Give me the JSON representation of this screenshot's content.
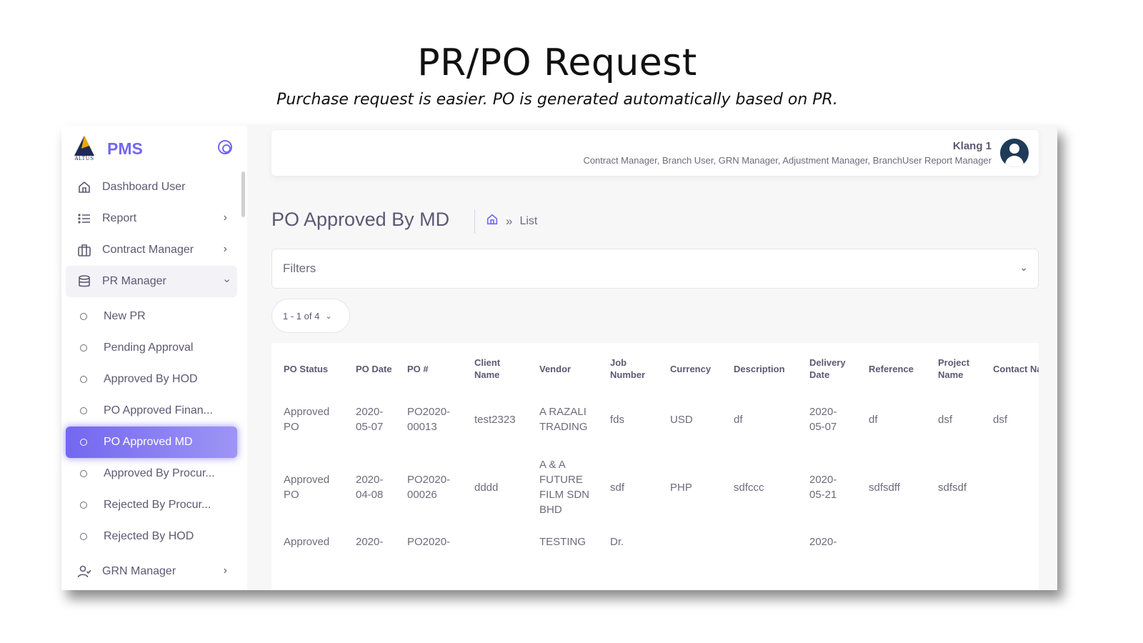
{
  "slide": {
    "title": "PR/PO Request",
    "subtitle": "Purchase request is easier. PO is generated automatically based on PR."
  },
  "app": {
    "name": "PMS",
    "logo_text": "ALTUS",
    "accent_color": "#7367f0"
  },
  "sidebar": {
    "items": [
      {
        "label": "Dashboard User",
        "icon": "home-icon"
      },
      {
        "label": "Report",
        "icon": "list-icon"
      },
      {
        "label": "Contract Manager",
        "icon": "briefcase-icon"
      },
      {
        "label": "PR Manager",
        "icon": "database-icon"
      }
    ],
    "pr_sub_items": [
      {
        "label": "New PR"
      },
      {
        "label": "Pending Approval"
      },
      {
        "label": "Approved By HOD"
      },
      {
        "label": "PO Approved Finan..."
      },
      {
        "label": "PO Approved MD",
        "active": true
      },
      {
        "label": "Approved By Procur..."
      },
      {
        "label": "Rejected By Procur..."
      },
      {
        "label": "Rejected By HOD"
      }
    ],
    "grn": {
      "label": "GRN Manager",
      "icon": "user-check-icon"
    }
  },
  "header": {
    "user_name": "Klang 1",
    "user_roles": "Contract Manager, Branch User, GRN Manager, Adjustment Manager, BranchUser Report Manager"
  },
  "page": {
    "title": "PO Approved By MD",
    "breadcrumb_sep": "»",
    "breadcrumb_current": "List",
    "filters_label": "Filters",
    "pager_label": "1 - 1 of 4"
  },
  "table": {
    "headers": [
      "PO Status",
      "PO Date",
      "PO #",
      "Client Name",
      "Vendor",
      "Job Number",
      "Currency",
      "Description",
      "Delivery Date",
      "Reference",
      "Project Name",
      "Contact Name"
    ],
    "rows": [
      [
        "Approved PO",
        "2020-05-07",
        "PO2020-00013",
        "test2323",
        "A RAZALI TRADING",
        "fds",
        "USD",
        "df",
        "2020-05-07",
        "df",
        "dsf",
        "dsf"
      ],
      [
        "Approved PO",
        "2020-04-08",
        "PO2020-00026",
        "dddd",
        "A & A FUTURE FILM SDN BHD",
        "sdf",
        "PHP",
        "sdfccc",
        "2020-05-21",
        "sdfsdff",
        "sdfsdf",
        ""
      ],
      [
        "Approved",
        "2020-",
        "PO2020-",
        "",
        "TESTING",
        "Dr.",
        "",
        "",
        "2020-",
        "",
        "",
        ""
      ]
    ]
  }
}
